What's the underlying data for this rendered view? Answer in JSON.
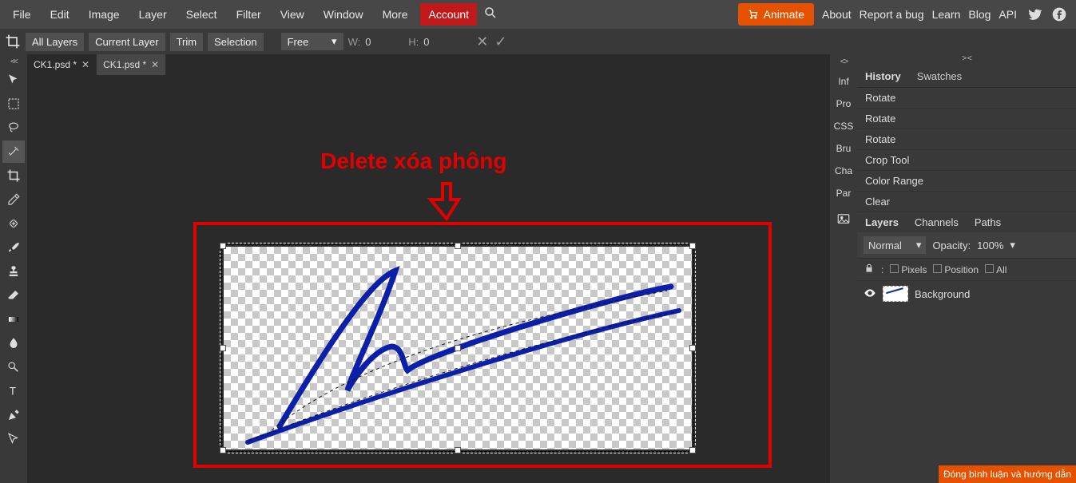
{
  "menu": {
    "items": [
      "File",
      "Edit",
      "Image",
      "Layer",
      "Select",
      "Filter",
      "View",
      "Window",
      "More"
    ],
    "account": "Account",
    "animate": "Animate",
    "rightLinks": [
      "About",
      "Report a bug",
      "Learn",
      "Blog",
      "API"
    ]
  },
  "options": {
    "buttons": [
      "All Layers",
      "Current Layer",
      "Trim",
      "Selection"
    ],
    "aspect": "Free",
    "wLabel": "W:",
    "wVal": "0",
    "hLabel": "H:",
    "hVal": "0"
  },
  "tabs": [
    {
      "title": "CK1.psd *",
      "active": true
    },
    {
      "title": "CK1.psd *",
      "active": false
    }
  ],
  "overlay": {
    "label": "Delete xóa phông"
  },
  "midtabs": [
    "Inf",
    "Pro",
    "CSS",
    "Bru",
    "Cha",
    "Par"
  ],
  "panels": {
    "historyTabs": [
      "History",
      "Swatches"
    ],
    "historyItems": [
      "Rotate",
      "Rotate",
      "Rotate",
      "Crop Tool",
      "Color Range",
      "Clear"
    ],
    "layerTabs": [
      "Layers",
      "Channels",
      "Paths"
    ],
    "blendMode": "Normal",
    "opacityLabel": "Opacity:",
    "opacityVal": "100%",
    "lockPixels": "Pixels",
    "lockPosition": "Position",
    "lockAll": "All",
    "layerName": "Background"
  },
  "banner": "Đóng bình luận và hướng dẫn"
}
